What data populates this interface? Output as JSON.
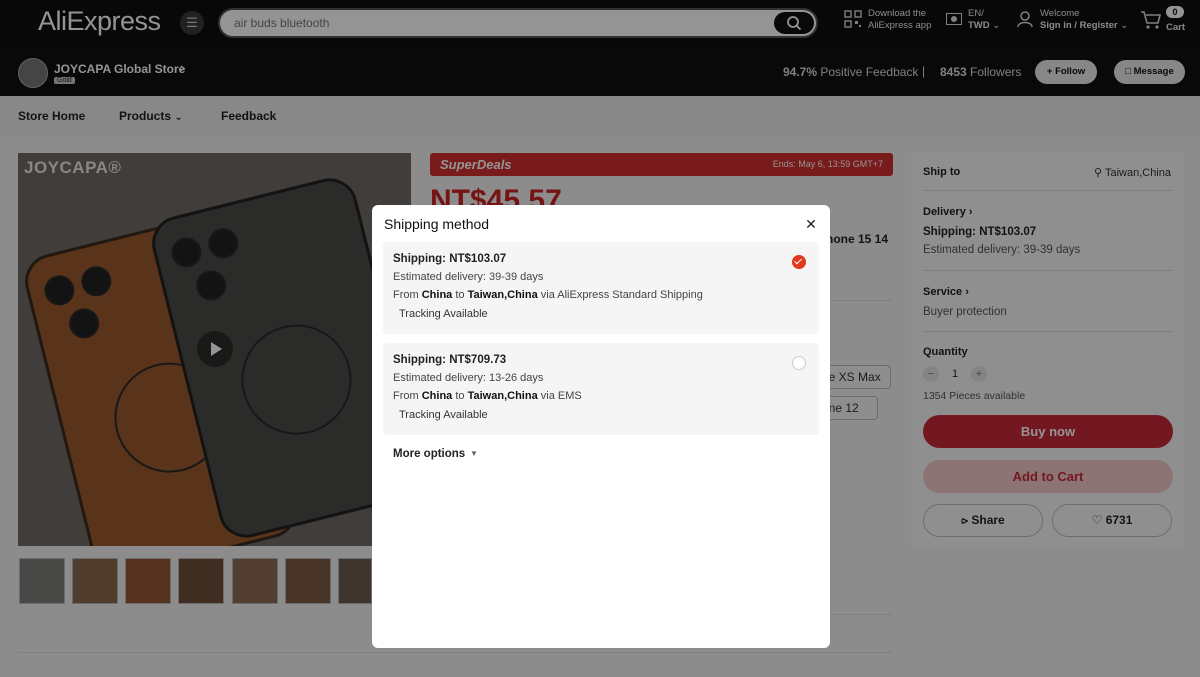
{
  "header": {
    "logo": "AliExpress",
    "search_placeholder": "air buds bluetooth",
    "download_line1": "Download the",
    "download_line2": "AliExpress app",
    "lang_line1": "EN/",
    "lang_line2": "TWD",
    "welcome_line1": "Welcome",
    "welcome_line2": "Sign in / Register",
    "cart_count": "0",
    "cart_label": "Cart"
  },
  "store": {
    "name": "JOYCAPA Global Store",
    "badge": "Gold",
    "positive_feedback_value": "94.7%",
    "positive_feedback_label": "Positive Feedback",
    "separator": "|",
    "followers_value": "8453",
    "followers_label": "Followers",
    "follow_label": "Follow",
    "message_label": "Message"
  },
  "nav": {
    "items": [
      "Store Home",
      "Products",
      "Feedback"
    ]
  },
  "gallery": {
    "brand_mark": "JOYCAPA®"
  },
  "product": {
    "superdeals_label": "SuperDeals",
    "ends_label": "Ends: May 6, 13:59 GMT+7",
    "price_peek": "NT$45.57",
    "title_peek": "hone 15 14",
    "variant_1": "ne XS Max",
    "variant_2": "one 12"
  },
  "right_panel": {
    "ship_to_label": "Ship to",
    "ship_to_value": "Taiwan,China",
    "delivery_label": "Delivery",
    "delivery_price": "Shipping: NT$103.07",
    "delivery_eta": "Estimated delivery: 39-39 days",
    "service_label": "Service",
    "service_value": "Buyer protection",
    "quantity_label": "Quantity",
    "quantity_value": "1",
    "stock": "1354 Pieces available",
    "buy_now": "Buy now",
    "add_to_cart": "Add to Cart",
    "share": "Share",
    "wishlist_count": "6731"
  },
  "modal": {
    "title": "Shipping method",
    "options": [
      {
        "price": "Shipping: NT$103.07",
        "eta": "Estimated delivery: 39-39 days",
        "from_word": "From",
        "from": "China",
        "to_word": "to",
        "to": "Taiwan,China",
        "via_word": "via",
        "carrier": "AliExpress Standard Shipping",
        "tag": "Tracking Available",
        "selected": true
      },
      {
        "price": "Shipping: NT$709.73",
        "eta": "Estimated delivery: 13-26 days",
        "from_word": "From",
        "from": "China",
        "to_word": "to",
        "to": "Taiwan,China",
        "via_word": "via",
        "carrier": "EMS",
        "tag": "Tracking Available",
        "selected": false
      }
    ],
    "more_options": "More options"
  },
  "colors": {
    "accent_red": "#d32f2f",
    "radio_selected": "#e0391b",
    "buy_now_bg": "#c62a38",
    "add_to_cart_bg": "#f3c9c9"
  },
  "icons": [
    "menu-icon",
    "search-icon",
    "qr-code-icon",
    "flag-icon",
    "user-icon",
    "cart-icon",
    "store-icon",
    "location-pin-icon",
    "share-icon",
    "heart-icon",
    "close-icon",
    "chevron-down-icon"
  ]
}
